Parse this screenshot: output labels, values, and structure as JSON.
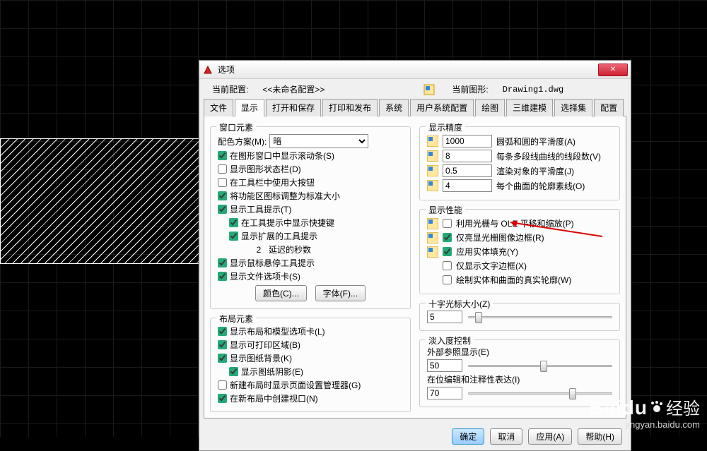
{
  "dialog": {
    "title": "选项",
    "current_config_label": "当前配置:",
    "current_config_value": "<<未命名配置>>",
    "current_drawing_label": "当前图形:",
    "current_drawing_value": "Drawing1.dwg"
  },
  "tabs": [
    "文件",
    "显示",
    "打开和保存",
    "打印和发布",
    "系统",
    "用户系统配置",
    "绘图",
    "三维建模",
    "选择集",
    "配置"
  ],
  "active_tab": 1,
  "left": {
    "window_elements": {
      "legend": "窗口元素",
      "color_scheme_label": "配色方案(M):",
      "color_scheme_value": "暗",
      "scrollbars": "在图形窗口中显示滚动条(S)",
      "statusbar": "显示图形状态栏(D)",
      "large_buttons": "在工具栏中使用大按钮",
      "resize_ribbon": "将功能区图标调整为标准大小",
      "tooltips": "显示工具提示(T)",
      "shortcut_keys": "在工具提示中显示快捷键",
      "extended_tooltips": "显示扩展的工具提示",
      "delay_value": "2",
      "delay_label": "延迟的秒数",
      "hover_tooltips": "显示鼠标悬停工具提示",
      "file_tabs": "显示文件选项卡(S)",
      "colors_btn": "颜色(C)...",
      "fonts_btn": "字体(F)..."
    },
    "layout_elements": {
      "legend": "布局元素",
      "layout_tabs": "显示布局和模型选项卡(L)",
      "printable": "显示可打印区域(B)",
      "paper_bg": "显示图纸背景(K)",
      "paper_shadow": "显示图纸阴影(E)",
      "new_layout_mgr": "新建布局时显示页面设置管理器(G)",
      "viewport": "在新布局中创建视口(N)"
    }
  },
  "right": {
    "precision": {
      "legend": "显示精度",
      "arc": {
        "value": "1000",
        "label": "圆弧和圆的平滑度(A)"
      },
      "segments": {
        "value": "8",
        "label": "每条多段线曲线的线段数(V)"
      },
      "render": {
        "value": "0.5",
        "label": "渲染对象的平滑度(J)"
      },
      "surface": {
        "value": "4",
        "label": "每个曲面的轮廓素线(O)"
      }
    },
    "performance": {
      "legend": "显示性能",
      "raster_ole": "利用光栅与 OLE 平移和缩放(P)",
      "highlight_raster": "仅亮显光栅图像边框(R)",
      "solid_fill": "应用实体填充(Y)",
      "text_boundary": "仅显示文字边框(X)",
      "silhouette": "绘制实体和曲面的真实轮廓(W)"
    },
    "crosshair": {
      "legend": "十字光标大小(Z)",
      "value": "5"
    },
    "fade": {
      "legend": "淡入度控制",
      "xref_label": "外部参照显示(E)",
      "xref_value": "50",
      "inplace_label": "在位编辑和注释性表达(I)",
      "inplace_value": "70"
    }
  },
  "buttons": {
    "ok": "确定",
    "cancel": "取消",
    "apply": "应用(A)",
    "help": "帮助(H)"
  },
  "watermark": {
    "brand": "Baidu",
    "cn": "经验",
    "url": "jingyan.baidu.com"
  }
}
